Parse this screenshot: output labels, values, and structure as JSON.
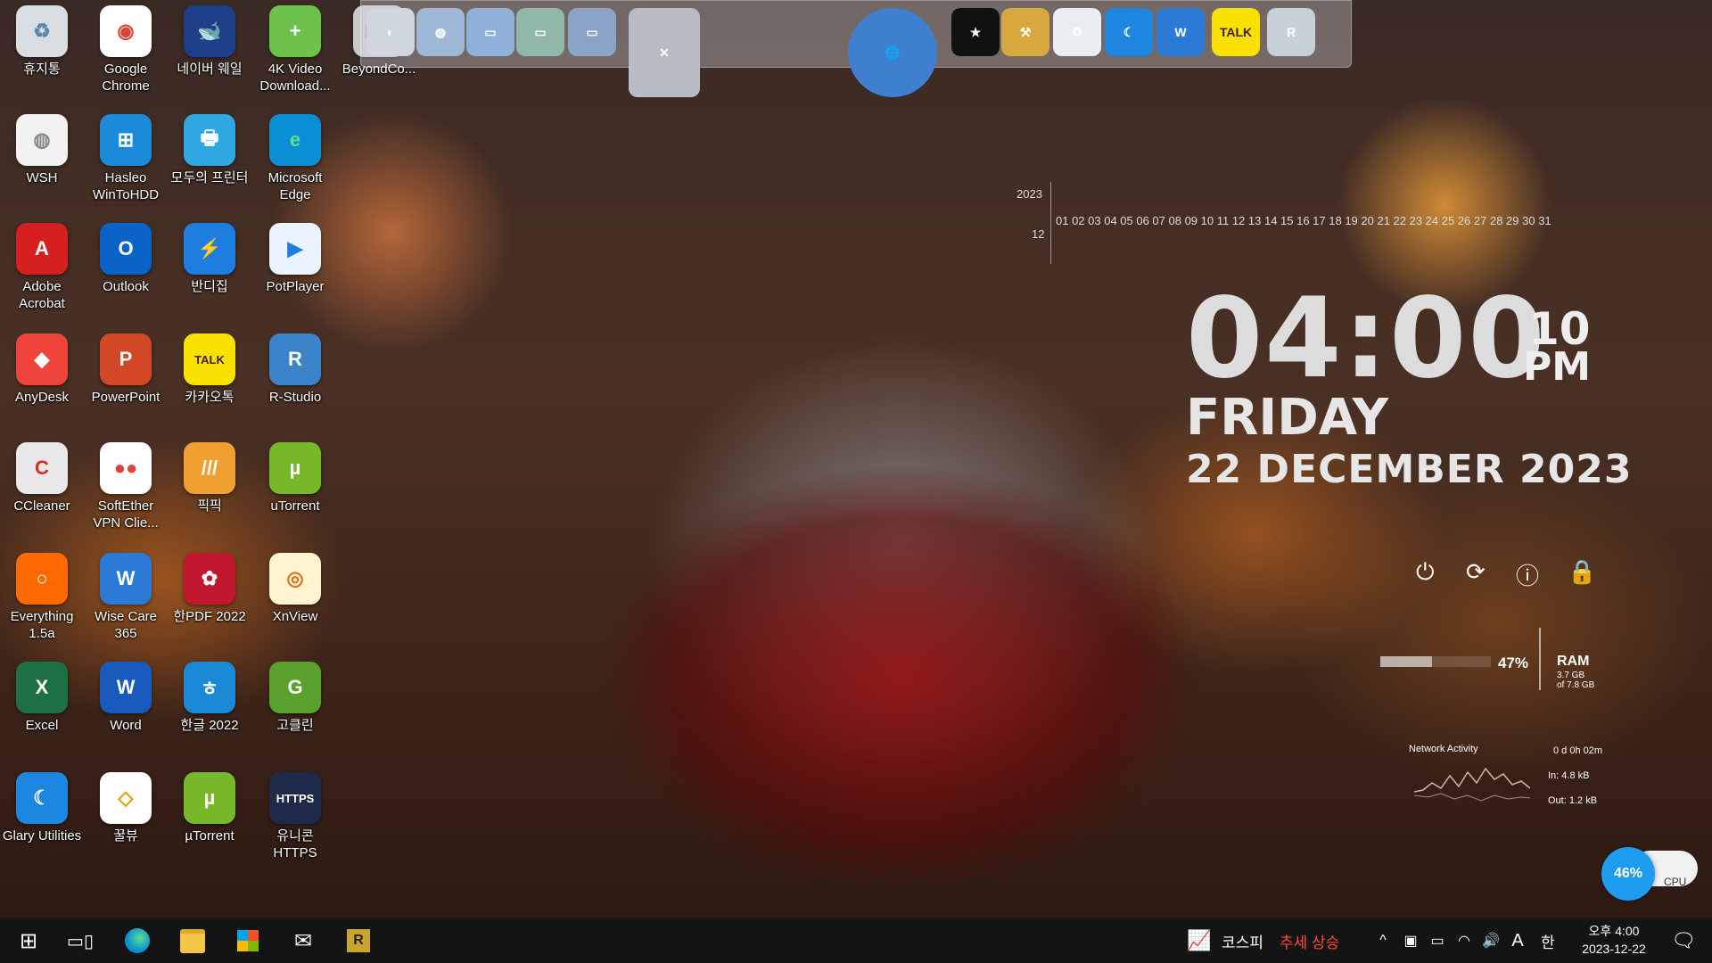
{
  "desktop_icons": [
    {
      "label": "휴지통",
      "icon": "recycle-bin-icon",
      "bg": "#d8dde2",
      "fg": "#5588aa",
      "text": "♻"
    },
    {
      "label": "Google Chrome",
      "icon": "chrome-icon",
      "bg": "#ffffff",
      "fg": "#db4437",
      "text": "◉"
    },
    {
      "label": "네이버 웨일",
      "icon": "naver-whale-icon",
      "bg": "#1d3f8a",
      "fg": "#ffffff",
      "text": "🐋"
    },
    {
      "label": "4K Video Download...",
      "icon": "4k-video-downloader-icon",
      "bg": "#6cc24a",
      "fg": "#ffffff",
      "text": "+"
    },
    {
      "label": "BeyondCo...",
      "icon": "beyond-compare-icon",
      "bg": "#c9c9c9",
      "fg": "#c0392b",
      "text": "BC"
    },
    {
      "label": "WSH",
      "icon": "wsh-script-icon",
      "bg": "#f2f2f2",
      "fg": "#888888",
      "text": "◍"
    },
    {
      "label": "Hasleo WinToHDD",
      "icon": "hasleo-wintohdd-icon",
      "bg": "#1b8ad8",
      "fg": "#ffffff",
      "text": "⊞"
    },
    {
      "label": "모두의 프린터",
      "icon": "printer-icon",
      "bg": "#2fa7e0",
      "fg": "#ffffff",
      "text": "🖶"
    },
    {
      "label": "Microsoft Edge",
      "icon": "edge-icon",
      "bg": "#0b8fd4",
      "fg": "#5de08c",
      "text": "e"
    },
    {
      "label": "Adobe Acrobat",
      "icon": "adobe-acrobat-icon",
      "bg": "#d61f1f",
      "fg": "#ffffff",
      "text": "A"
    },
    {
      "label": "Outlook",
      "icon": "outlook-icon",
      "bg": "#0a64c8",
      "fg": "#ffffff",
      "text": "O"
    },
    {
      "label": "반디집",
      "icon": "bandizip-icon",
      "bg": "#1e7ee0",
      "fg": "#ffffff",
      "text": "⚡"
    },
    {
      "label": "PotPlayer",
      "icon": "potplayer-icon",
      "bg": "#eaf4ff",
      "fg": "#1e7ee0",
      "text": "▶"
    },
    {
      "label": "AnyDesk",
      "icon": "anydesk-icon",
      "bg": "#ef443b",
      "fg": "#ffffff",
      "text": "◆"
    },
    {
      "label": "PowerPoint",
      "icon": "powerpoint-icon",
      "bg": "#d24726",
      "fg": "#ffffff",
      "text": "P"
    },
    {
      "label": "카카오톡",
      "icon": "kakaotalk-icon",
      "bg": "#fae100",
      "fg": "#3c1e1e",
      "text": "TALK"
    },
    {
      "label": "R-Studio",
      "icon": "r-studio-icon",
      "bg": "#3b84c9",
      "fg": "#ffffff",
      "text": "R"
    },
    {
      "label": "CCleaner",
      "icon": "ccleaner-icon",
      "bg": "#e8e8e8",
      "fg": "#d62d20",
      "text": "C"
    },
    {
      "label": "SoftEther VPN Clie...",
      "icon": "softether-vpn-icon",
      "bg": "#ffffff",
      "fg": "#e04040",
      "text": "●●"
    },
    {
      "label": "픽픽",
      "icon": "picpick-icon",
      "bg": "#f0a030",
      "fg": "#ffffff",
      "text": "///"
    },
    {
      "label": "uTorrent",
      "icon": "utorrent-icon",
      "bg": "#76b82a",
      "fg": "#ffffff",
      "text": "µ"
    },
    {
      "label": "Everything 1.5a",
      "icon": "everything-search-icon",
      "bg": "#ff6a00",
      "fg": "#ffffff",
      "text": "○"
    },
    {
      "label": "Wise Care 365",
      "icon": "wise-care-icon",
      "bg": "#2b7bd6",
      "fg": "#ffffff",
      "text": "W"
    },
    {
      "label": "한PDF 2022",
      "icon": "hanpdf-icon",
      "bg": "#c0182f",
      "fg": "#ffffff",
      "text": "✿"
    },
    {
      "label": "XnView",
      "icon": "xnview-icon",
      "bg": "#fff3d0",
      "fg": "#e07020",
      "text": "◎"
    },
    {
      "label": "Excel",
      "icon": "excel-icon",
      "bg": "#1d7044",
      "fg": "#ffffff",
      "text": "X"
    },
    {
      "label": "Word",
      "icon": "word-icon",
      "bg": "#185abd",
      "fg": "#ffffff",
      "text": "W"
    },
    {
      "label": "한글 2022",
      "icon": "hangul-icon",
      "bg": "#1a8ad6",
      "fg": "#ffffff",
      "text": "ㅎ"
    },
    {
      "label": "고클린",
      "icon": "goclean-icon",
      "bg": "#5aa02c",
      "fg": "#ffffff",
      "text": "G"
    },
    {
      "label": "Glary Utilities",
      "icon": "glary-utilities-icon",
      "bg": "#1c86e0",
      "fg": "#ffffff",
      "text": "☾"
    },
    {
      "label": "꿀뷰",
      "icon": "honeyview-icon",
      "bg": "#ffffff",
      "fg": "#e0a000",
      "text": "◇"
    },
    {
      "label": "µTorrent",
      "icon": "utorrent-icon",
      "bg": "#76b82a",
      "fg": "#ffffff",
      "text": "µ"
    },
    {
      "label": "유니콘 HTTPS",
      "icon": "unicorn-https-icon",
      "bg": "#1e2a4a",
      "fg": "#ffffff",
      "text": "HTTPS"
    }
  ],
  "dock_items": [
    {
      "icon": "disk-icon",
      "bg": "#cfd6de",
      "text": "◐"
    },
    {
      "icon": "network-globe-icon",
      "bg": "#9fb8d8",
      "text": "◍"
    },
    {
      "icon": "folder-icon",
      "bg": "#8fb0d8",
      "text": "▭"
    },
    {
      "icon": "folder-open-icon",
      "bg": "#8fb8a8",
      "text": "▭"
    },
    {
      "icon": "folder-docs-icon",
      "bg": "#8aa4c8",
      "text": "▭"
    },
    {
      "icon": "tools-icon",
      "bg": "#b8bcc4",
      "text": "✕"
    },
    {
      "icon": "globe-icon",
      "bg": "#3f7fd0",
      "text": "🌐"
    },
    {
      "icon": "tshirt-icon",
      "bg": "#111111",
      "text": "★"
    },
    {
      "icon": "hammer-icon",
      "bg": "#d8a840",
      "text": "⚒"
    },
    {
      "icon": "recycle-bin-icon",
      "bg": "#e8eef2",
      "text": "♻"
    },
    {
      "icon": "glary-moon-icon",
      "bg": "#1c86e0",
      "text": "☾"
    },
    {
      "icon": "wise-shield-icon",
      "bg": "#2b7bd6",
      "text": "W"
    },
    {
      "icon": "kakaotalk-icon",
      "bg": "#fae100",
      "text": "TALK"
    },
    {
      "icon": "r-studio-icon",
      "bg": "#c8d0d8",
      "text": "R"
    }
  ],
  "calendar": {
    "year": "2023",
    "month": "12",
    "days": "01 02 03 04 05 06 07 08 09 10 11 12 13 14 15 16 17 18 19 20 21 22 23 24 25 26 27 28 29 30 31"
  },
  "clock": {
    "time": "04:00",
    "seconds": "10",
    "ampm": "PM",
    "day": "FRIDAY",
    "date": "22 DECEMBER  2023"
  },
  "ram": {
    "percent": "47%",
    "label": "RAM",
    "used": "3.7 GB",
    "total": "of 7.8 GB",
    "fill": 0.47
  },
  "network": {
    "label": "Network Activity",
    "uptime": "0 d 0h 02m",
    "in": "In: 4.8 kB",
    "out": "Out: 1.2 kB"
  },
  "cpu": {
    "percent": "46%",
    "label": "CPU"
  },
  "taskbar": {
    "ticker_a": "코스피",
    "ticker_b": "추세 상승",
    "clock_time": "오후 4:00",
    "clock_date": "2023-12-22",
    "ime_a": "A",
    "ime_b": "한"
  },
  "colors": {
    "ticker_red": "#ff4a3a",
    "cpu_blue": "#1e9cf0",
    "clock_text": "#dcdcdc"
  }
}
